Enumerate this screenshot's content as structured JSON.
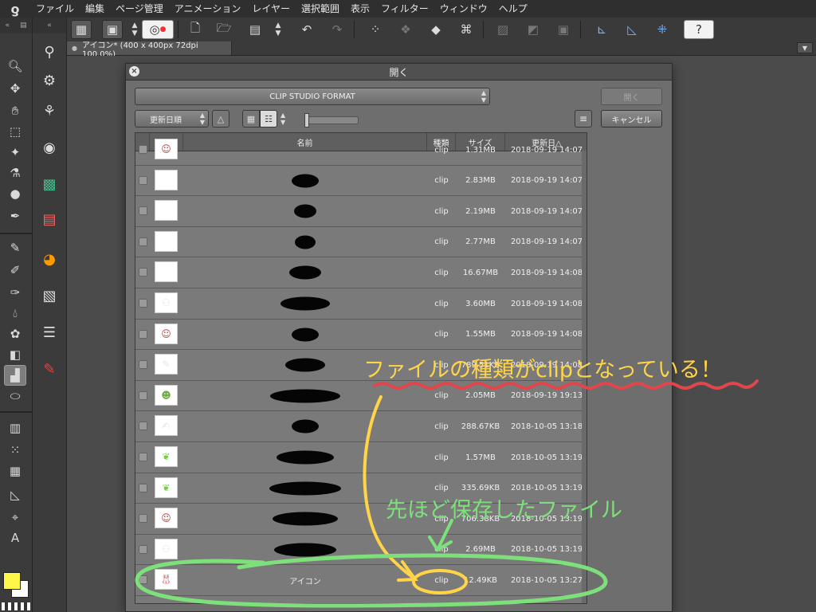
{
  "app": {
    "logo_glyph": "ƍ",
    "menu": [
      "ファイル",
      "編集",
      "ページ管理",
      "アニメーション",
      "レイヤー",
      "選択範囲",
      "表示",
      "フィルター",
      "ウィンドウ",
      "ヘルプ"
    ]
  },
  "document_tab": {
    "title": "アイコン* (400 x 400px 72dpi 100.0%)"
  },
  "dialog": {
    "title": "開く",
    "close_glyph": "×",
    "format": "CLIP STUDIO FORMAT",
    "open_label": "開く",
    "cancel_label": "キャンセル",
    "sort_label": "更新日順",
    "sort_dir_glyph": "△",
    "menu_glyph": "≡"
  },
  "file_list": {
    "columns": {
      "name": "名前",
      "type": "種類",
      "size": "サイズ",
      "date": "更新日△"
    },
    "rows": [
      {
        "name": "",
        "type": "clip",
        "size": "1.31MB",
        "date": "2018-09-19 14:07",
        "thumb": "face",
        "redacted": false,
        "partial": true
      },
      {
        "name": "",
        "type": "clip",
        "size": "2.83MB",
        "date": "2018-09-19 14:07",
        "thumb": "blank",
        "redacted": true
      },
      {
        "name": "",
        "type": "clip",
        "size": "2.19MB",
        "date": "2018-09-19 14:07",
        "thumb": "blank",
        "redacted": true
      },
      {
        "name": "",
        "type": "clip",
        "size": "2.77MB",
        "date": "2018-09-19 14:07",
        "thumb": "blank",
        "redacted": true
      },
      {
        "name": "",
        "type": "clip",
        "size": "16.67MB",
        "date": "2018-09-19 14:08",
        "thumb": "blank",
        "redacted": true
      },
      {
        "name": "",
        "type": "clip",
        "size": "3.60MB",
        "date": "2018-09-19 14:08",
        "thumb": "people",
        "redacted": true
      },
      {
        "name": "",
        "type": "clip",
        "size": "1.55MB",
        "date": "2018-09-19 14:08",
        "thumb": "face",
        "redacted": true
      },
      {
        "name": "",
        "type": "clip",
        "size": "789.51KB",
        "date": "2018-09-19 14:08",
        "thumb": "sketch",
        "redacted": true
      },
      {
        "name": "",
        "type": "clip",
        "size": "2.05MB",
        "date": "2018-09-19 19:13",
        "thumb": "avatar",
        "redacted": true
      },
      {
        "name": "",
        "type": "clip",
        "size": "288.67KB",
        "date": "2018-10-05 13:18",
        "thumb": "text",
        "redacted": true
      },
      {
        "name": "",
        "type": "clip",
        "size": "1.57MB",
        "date": "2018-10-05 13:19",
        "thumb": "leaf",
        "redacted": true
      },
      {
        "name": "",
        "type": "clip",
        "size": "335.69KB",
        "date": "2018-10-05 13:19",
        "thumb": "leaf",
        "redacted": true
      },
      {
        "name": "",
        "type": "clip",
        "size": "706.38KB",
        "date": "2018-10-05 13:19",
        "thumb": "face",
        "redacted": true
      },
      {
        "name": "",
        "type": "clip",
        "size": "2.69MB",
        "date": "2018-10-05 13:19",
        "thumb": "people",
        "redacted": true
      },
      {
        "name": "アイコン",
        "type": "clip",
        "size": "12.49KB",
        "date": "2018-10-05 13:27",
        "thumb": "rabbit",
        "redacted": false
      }
    ]
  },
  "annotations": {
    "note_type": "ファイルの種類がclipとなっている！",
    "note_saved": "先ほど保存したファイル",
    "yellow": "#ffd449",
    "green": "#7ee07a",
    "red": "#e0474c"
  },
  "colors": {
    "foreground": "#fff64a",
    "background": "#ffffff"
  }
}
